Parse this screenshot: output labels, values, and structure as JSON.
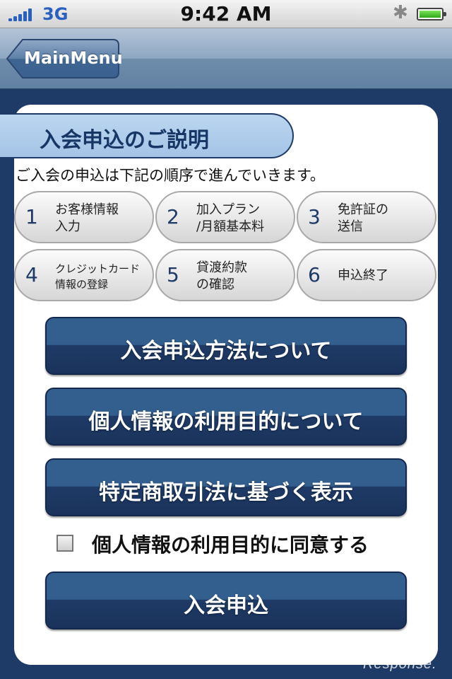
{
  "status_bar": {
    "network": "3G",
    "time": "9:42 AM"
  },
  "nav": {
    "back_label": "MainMenu"
  },
  "section": {
    "title": "入会申込のご説明",
    "intro": "ご入会の申込は下記の順序で進んでいきます。"
  },
  "steps": [
    {
      "num": "1",
      "line1": "お客様情報",
      "line2": "入力"
    },
    {
      "num": "2",
      "line1": "加入プラン",
      "line2": "/月額基本料"
    },
    {
      "num": "3",
      "line1": "免許証の",
      "line2": "送信"
    },
    {
      "num": "4",
      "line1": "クレジットカード",
      "line2": "情報の登録"
    },
    {
      "num": "5",
      "line1": "貸渡約款",
      "line2": "の確認"
    },
    {
      "num": "6",
      "line1": "申込終了",
      "line2": ""
    }
  ],
  "buttons": {
    "method": "入会申込方法について",
    "purpose": "個人情報の利用目的について",
    "commerce": "特定商取引法に基づく表示",
    "submit": "入会申込"
  },
  "agree": {
    "label": "個人情報の利用目的に同意する",
    "checked": false
  },
  "watermark": "Response."
}
